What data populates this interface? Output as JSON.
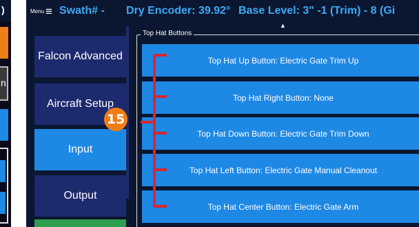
{
  "left_panel": {
    "top_text": ")",
    "gray_text": "n"
  },
  "titlebar": {
    "menu_label": "Menu",
    "menu_icon": "hamburger-icon",
    "swath": "Swath# -",
    "encoder": "Dry Encoder: 39.92°",
    "base_level": "Base Level: 3\" -1 (Trim) - 8 (Gi"
  },
  "sidebar": {
    "items": [
      {
        "label": "Falcon Advanced",
        "active": false
      },
      {
        "label": "Aircraft Setup",
        "active": false
      },
      {
        "label": "Input",
        "active": true
      },
      {
        "label": "Output",
        "active": false
      }
    ]
  },
  "main": {
    "scroll_up_icon": "triangle-up-icon",
    "group_title": "Top Hat Buttons",
    "buttons": [
      {
        "label": "Top Hat Up Button: Electric Gate Trim Up"
      },
      {
        "label": "Top Hat Right Button: None"
      },
      {
        "label": "Top Hat Down Button: Electric Gate Trim Down"
      },
      {
        "label": "Top Hat Left Button: Electric Gate Manual Cleanout"
      },
      {
        "label": "Top Hat Center Button: Electric Gate Arm"
      }
    ],
    "chevron_icon": "chevron-down-icon"
  },
  "annotation": {
    "badge": "15"
  },
  "colors": {
    "background": "#0b1730",
    "title_accent": "#3ea9f5",
    "button_blue": "#1e88e5",
    "sidebar_navy": "#1e2a6e",
    "badge_orange": "#f07e16",
    "bracket_red": "#d8272f",
    "nav_green": "#2e9e4f"
  }
}
